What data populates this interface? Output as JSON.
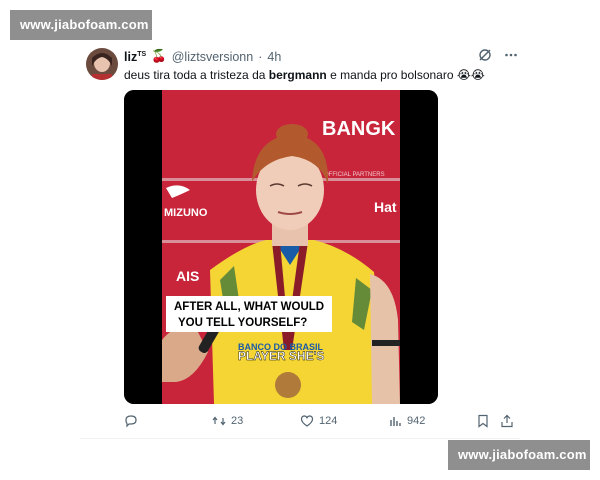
{
  "watermark": {
    "top": "www.jiabofoam.com",
    "bottom": "www.jiabofoam.com"
  },
  "tweet": {
    "display_name": "liz",
    "display_name_suffix": "TS",
    "handle": "@liztsversionn",
    "separator": "·",
    "time": "4h",
    "text_part1": "deus tira toda a tristeza da ",
    "text_bold": "bergmann",
    "text_part2": " e manda pro bolsonaro 😭😭",
    "emoji_badge": "🍒"
  },
  "media": {
    "banner_text": "BANGK",
    "sponsor_1": "MIZUNO",
    "sponsor_2": "Hat",
    "sponsor_3": "AIS",
    "sponsor_partners": "OFFICIAL PARTNERS",
    "subtitle_line1": "AFTER ALL, WHAT WOULD",
    "subtitle_line2": "YOU TELL YOURSELF?",
    "caption": "PLAYER SHE'S",
    "shirt_text": "BANCO DO BRASIL"
  },
  "actions": {
    "reply_count": "",
    "retweet_count": "23",
    "like_count": "124",
    "views_count": "942"
  },
  "colors": {
    "text_primary": "#0f1419",
    "text_secondary": "#536471",
    "banner_red": "#c8243a",
    "jersey_yellow": "#f4d534"
  }
}
